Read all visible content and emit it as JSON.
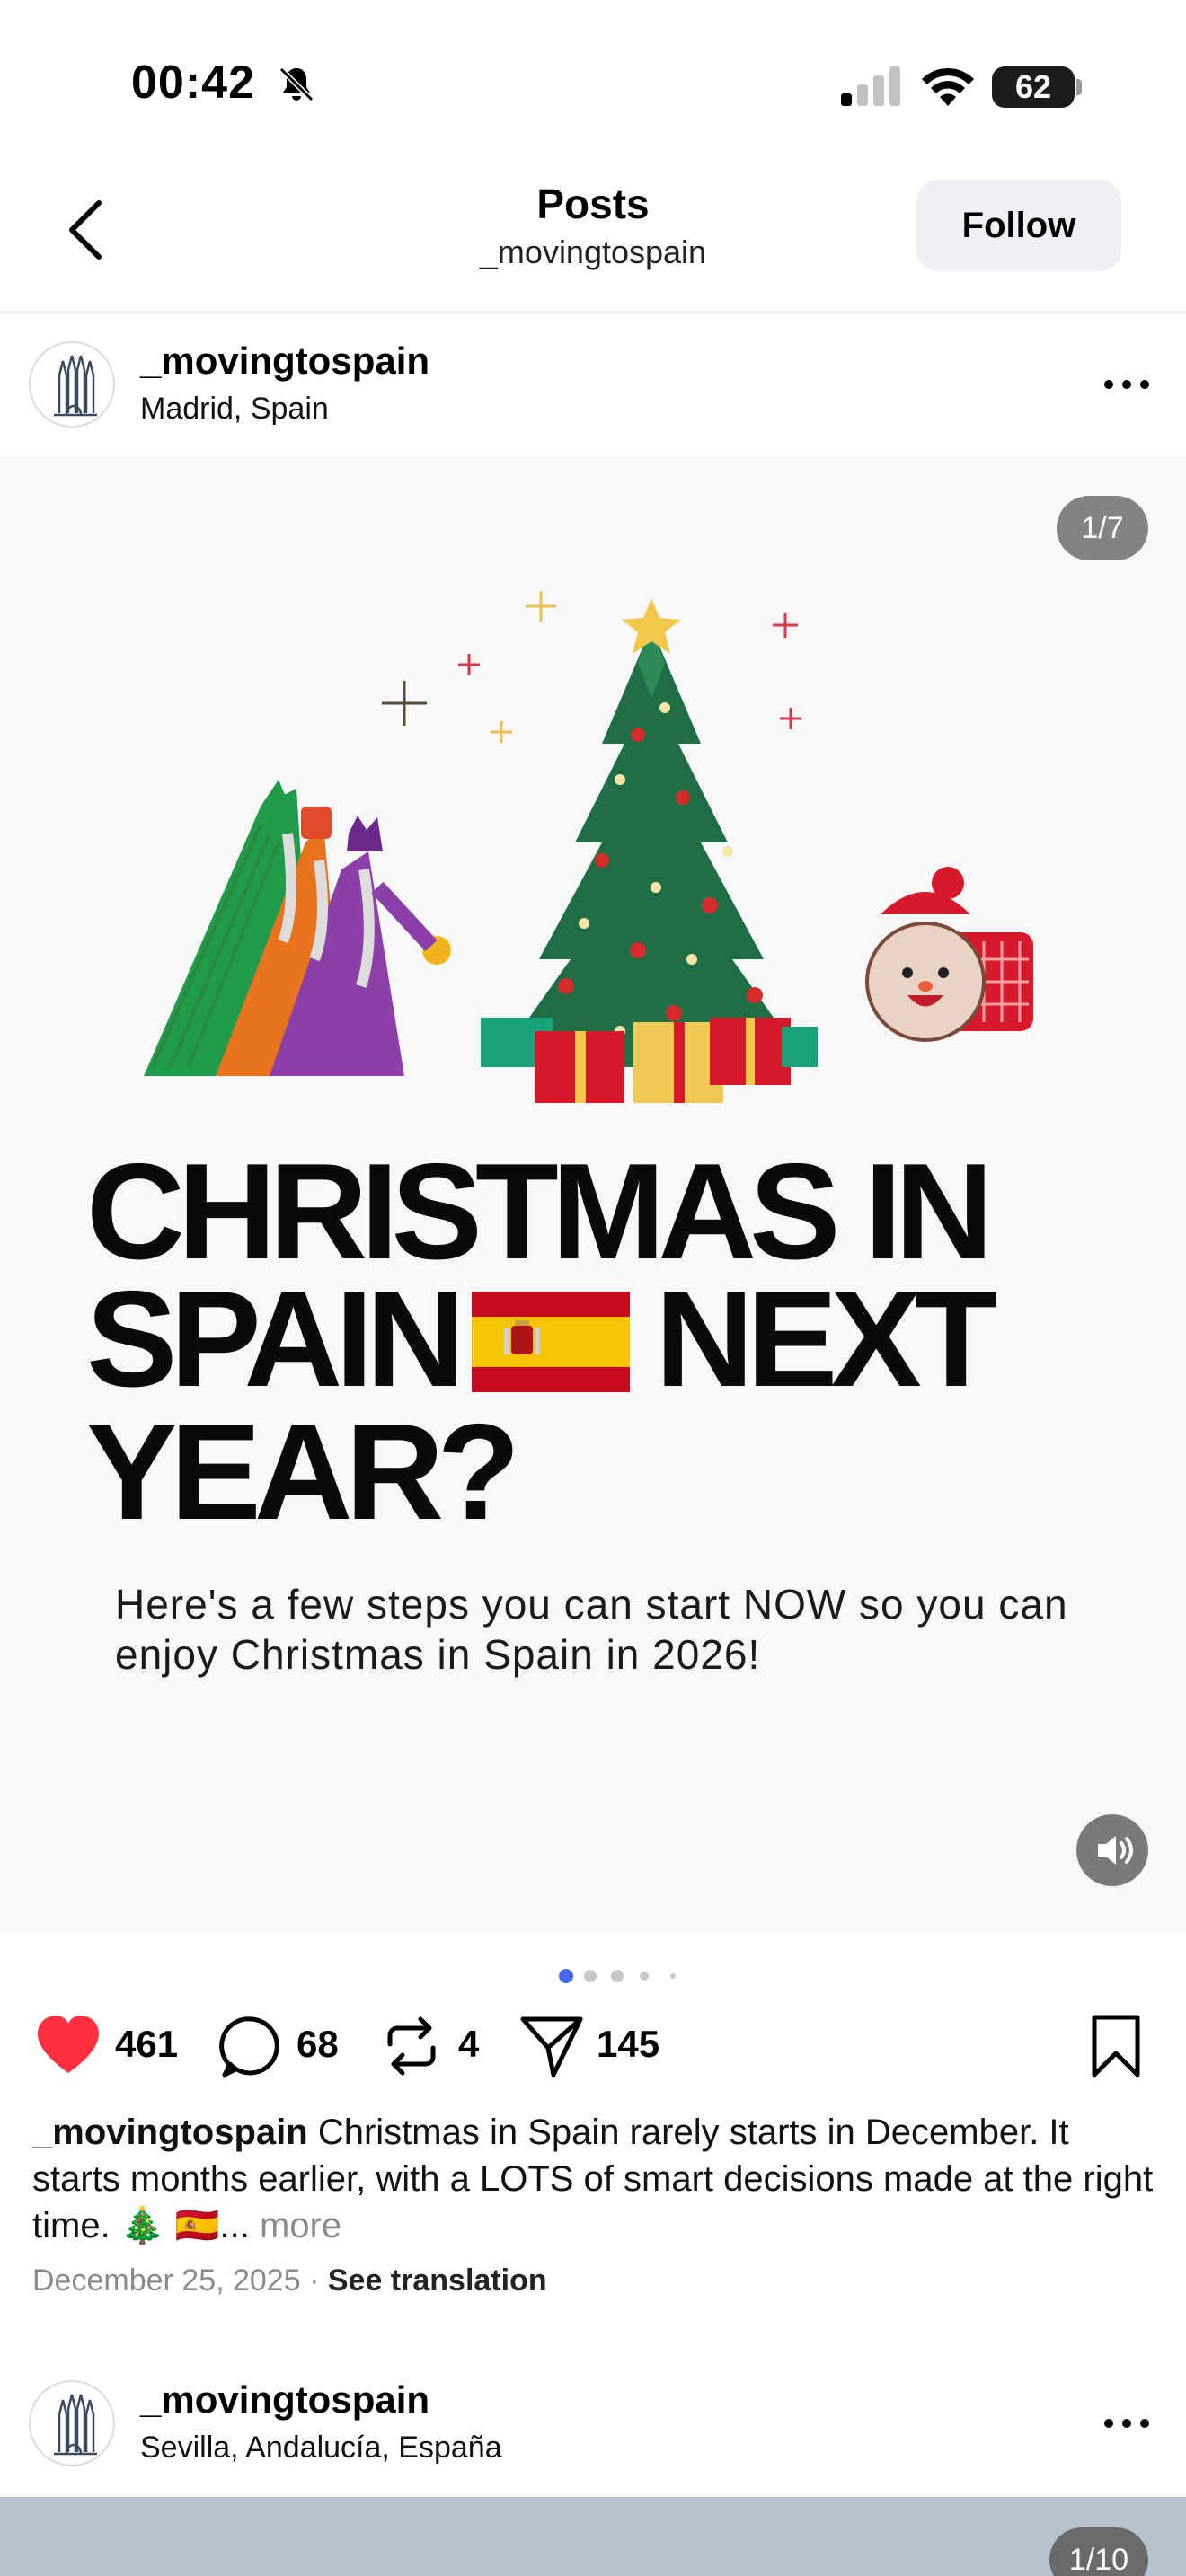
{
  "status_bar": {
    "time": "00:42",
    "battery": "62"
  },
  "header": {
    "title": "Posts",
    "subtitle": "_movingtospain",
    "follow_label": "Follow"
  },
  "post1": {
    "username": "_movingtospain",
    "location": "Madrid, Spain",
    "page_indicator": "1/7",
    "headline_line1": "CHRISTMAS IN",
    "headline_line2a": "SPAIN",
    "headline_line2b": "NEXT",
    "headline_line3": "YEAR?",
    "body": "Here's a few steps you can start NOW so you can enjoy Christmas in Spain in 2026!",
    "likes": "461",
    "comments": "68",
    "reposts": "4",
    "shares": "145",
    "caption_user": "_movingtospain",
    "caption_text": " Christmas in Spain rarely starts in December. It starts months earlier, with a LOTS of smart decisions made at the right time. 🎄 🇪🇸...",
    "caption_more": " more",
    "date": "December 25, 2025",
    "separator": " · ",
    "see_translation": "See translation"
  },
  "post2": {
    "username": "_movingtospain",
    "location": "Sevilla, Andalucía, España",
    "page_indicator": "1/10"
  },
  "colors": {
    "like_red": "#ff3040",
    "active_dot": "#4a67f2",
    "follow_bg": "#efeff4"
  },
  "icons": [
    "bell-slash-icon",
    "signal-icon",
    "wifi-icon",
    "back-icon",
    "more-icon",
    "heart-icon",
    "comment-icon",
    "repost-icon",
    "share-icon",
    "bookmark-icon",
    "speaker-icon"
  ]
}
